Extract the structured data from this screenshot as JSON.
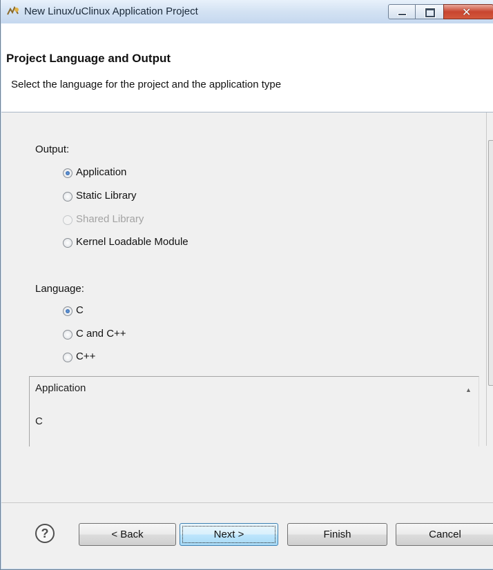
{
  "window": {
    "title": "New Linux/uClinux Application Project",
    "icon": "eclipse-wizard-icon"
  },
  "banner": {
    "title": "Project Language and Output",
    "description": "Select the language for the project and the application type"
  },
  "output": {
    "label": "Output:",
    "options": [
      {
        "label": "Application",
        "checked": true,
        "disabled": false
      },
      {
        "label": "Static Library",
        "checked": false,
        "disabled": false
      },
      {
        "label": "Shared Library",
        "checked": false,
        "disabled": true
      },
      {
        "label": "Kernel Loadable Module",
        "checked": false,
        "disabled": false
      }
    ]
  },
  "language": {
    "label": "Language:",
    "options": [
      {
        "label": "C",
        "checked": true
      },
      {
        "label": "C and C++",
        "checked": false
      },
      {
        "label": "C++",
        "checked": false
      }
    ]
  },
  "summary": {
    "line1": "Application",
    "line2": "C"
  },
  "footer": {
    "help_icon": "question-icon",
    "back": "< Back",
    "next": "Next >",
    "finish": "Finish",
    "cancel": "Cancel"
  }
}
